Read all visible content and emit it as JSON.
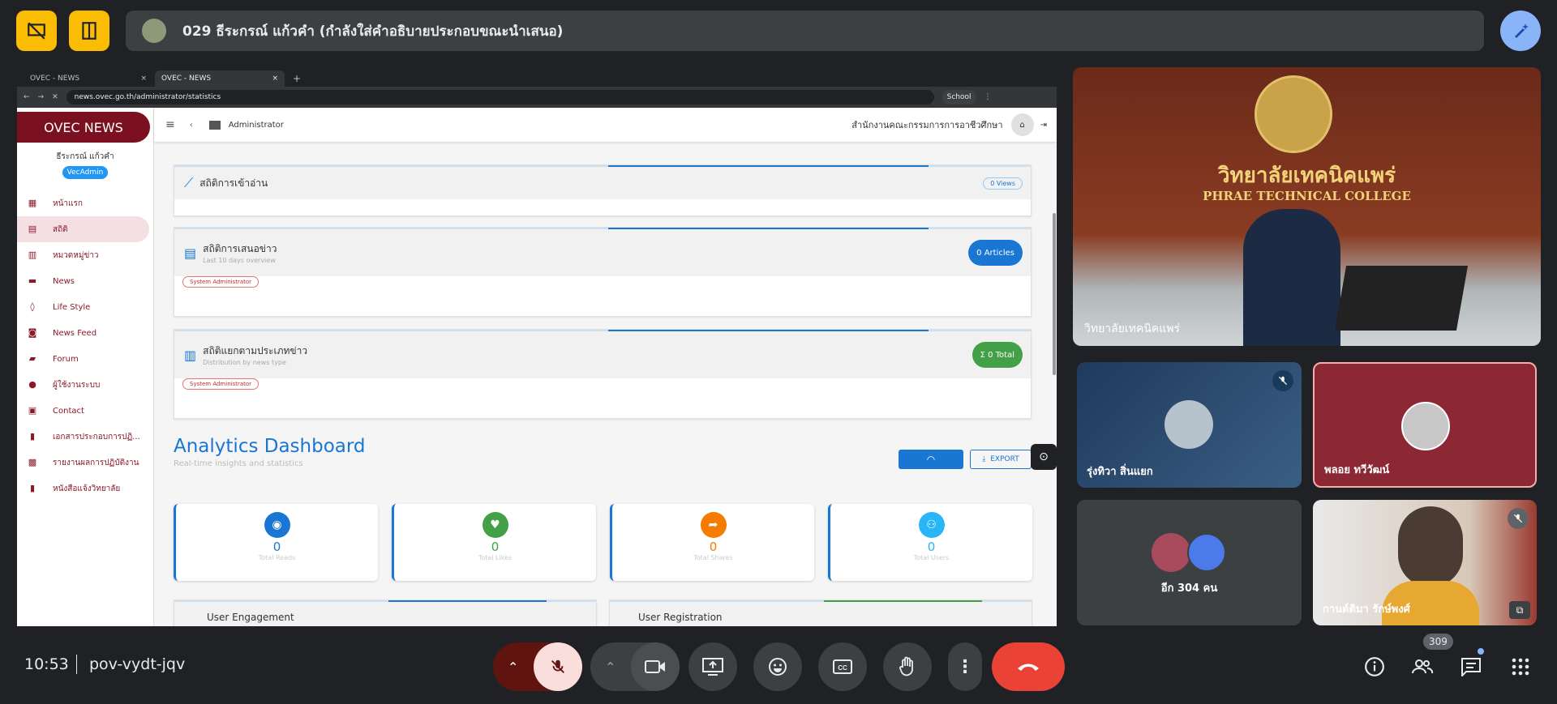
{
  "presenter": {
    "label": "029 ธีระกรณ์ แก้วคำ (กำลังใส่คำอธิบายประกอบขณะนำเสนอ)"
  },
  "browser": {
    "tabs": [
      {
        "label": "OVEC - NEWS"
      },
      {
        "label": "OVEC - NEWS"
      }
    ],
    "url": "news.ovec.go.th/administrator/statistics",
    "profile": "School"
  },
  "site": {
    "brand": "OVEC NEWS",
    "user_name": "ธีระกรณ์ แก้วคำ",
    "role": "VecAdmin",
    "nav": [
      {
        "label": "หน้าแรก",
        "icon": "grid-icon",
        "glyph": "▦"
      },
      {
        "label": "สถิติ",
        "icon": "chart-icon",
        "glyph": "▤"
      },
      {
        "label": "หมวดหมู่ข่าว",
        "icon": "category-icon",
        "glyph": "▥"
      },
      {
        "label": "News",
        "icon": "news-icon",
        "glyph": "▬"
      },
      {
        "label": "Life Style",
        "icon": "lifestyle-icon",
        "glyph": "◊"
      },
      {
        "label": "News Feed",
        "icon": "rss-icon",
        "glyph": "◙"
      },
      {
        "label": "Forum",
        "icon": "forum-icon",
        "glyph": "▰"
      },
      {
        "label": "ผู้ใช้งานระบบ",
        "icon": "users-icon",
        "glyph": "●"
      },
      {
        "label": "Contact",
        "icon": "contact-icon",
        "glyph": "▣"
      },
      {
        "label": "เอกสารประกอบการปฏิ...",
        "icon": "document-icon",
        "glyph": "▮"
      },
      {
        "label": "รายงานผลการปฏิบัติงาน",
        "icon": "print-icon",
        "glyph": "▩"
      },
      {
        "label": "หนังสือแจ้งวิทยาลัย",
        "icon": "book-icon",
        "glyph": "▮"
      }
    ],
    "breadcrumb": "Administrator",
    "org_name": "สำนักงานคณะกรรมการการอาชีวศึกษา",
    "cards": [
      {
        "title": "สถิติการเข้าอ่าน",
        "badge": "0 Views"
      },
      {
        "title": "สถิติการเสนอข่าว",
        "subtitle": "Last 10 days overview",
        "badge": "0 Articles",
        "tag": "System Administrator"
      },
      {
        "title": "สถิติแยกตามประเภทข่าว",
        "subtitle": "Distribution by news type",
        "badge": "Σ 0 Total",
        "tag": "System Administrator"
      }
    ],
    "analytics": {
      "title": "Analytics Dashboard",
      "subtitle": "Real-time insights and statistics",
      "export": "EXPORT",
      "stats": [
        {
          "value": "0",
          "label": "Total Reads",
          "color": "#1976d2",
          "icon": "eye-icon"
        },
        {
          "value": "0",
          "label": "Total Likes",
          "color": "#43a047",
          "icon": "heart-icon"
        },
        {
          "value": "0",
          "label": "Total Shares",
          "color": "#f57c00",
          "icon": "share-icon"
        },
        {
          "value": "0",
          "label": "Total Users",
          "color": "#29b6f6",
          "icon": "group-icon"
        }
      ],
      "engagement": "User Engagement",
      "registration": "User Registration"
    }
  },
  "participants": {
    "main": {
      "name": "วิทยาลัยเทคนิคแพร่",
      "banner_th": "วิทยาลัยเทคนิคแพร่",
      "banner_en": "PHRAE TECHNICAL COLLEGE"
    },
    "tiles": [
      {
        "name": "รุ่งทิวา สิ่นแยก"
      },
      {
        "name": "พลอย ทวีวัฒน์"
      },
      {
        "name": "อีก 304 คน"
      },
      {
        "name": "กานต์ติมา รักษ์พงศ์"
      }
    ]
  },
  "meeting": {
    "time": "10:53",
    "code": "pov-vydt-jqv",
    "people_count": "309"
  },
  "colors": {
    "end_call": "#ea4335",
    "mic_off": "#f9dedc",
    "accent_yellow": "#fbbc04",
    "brand": "#7b1020"
  }
}
